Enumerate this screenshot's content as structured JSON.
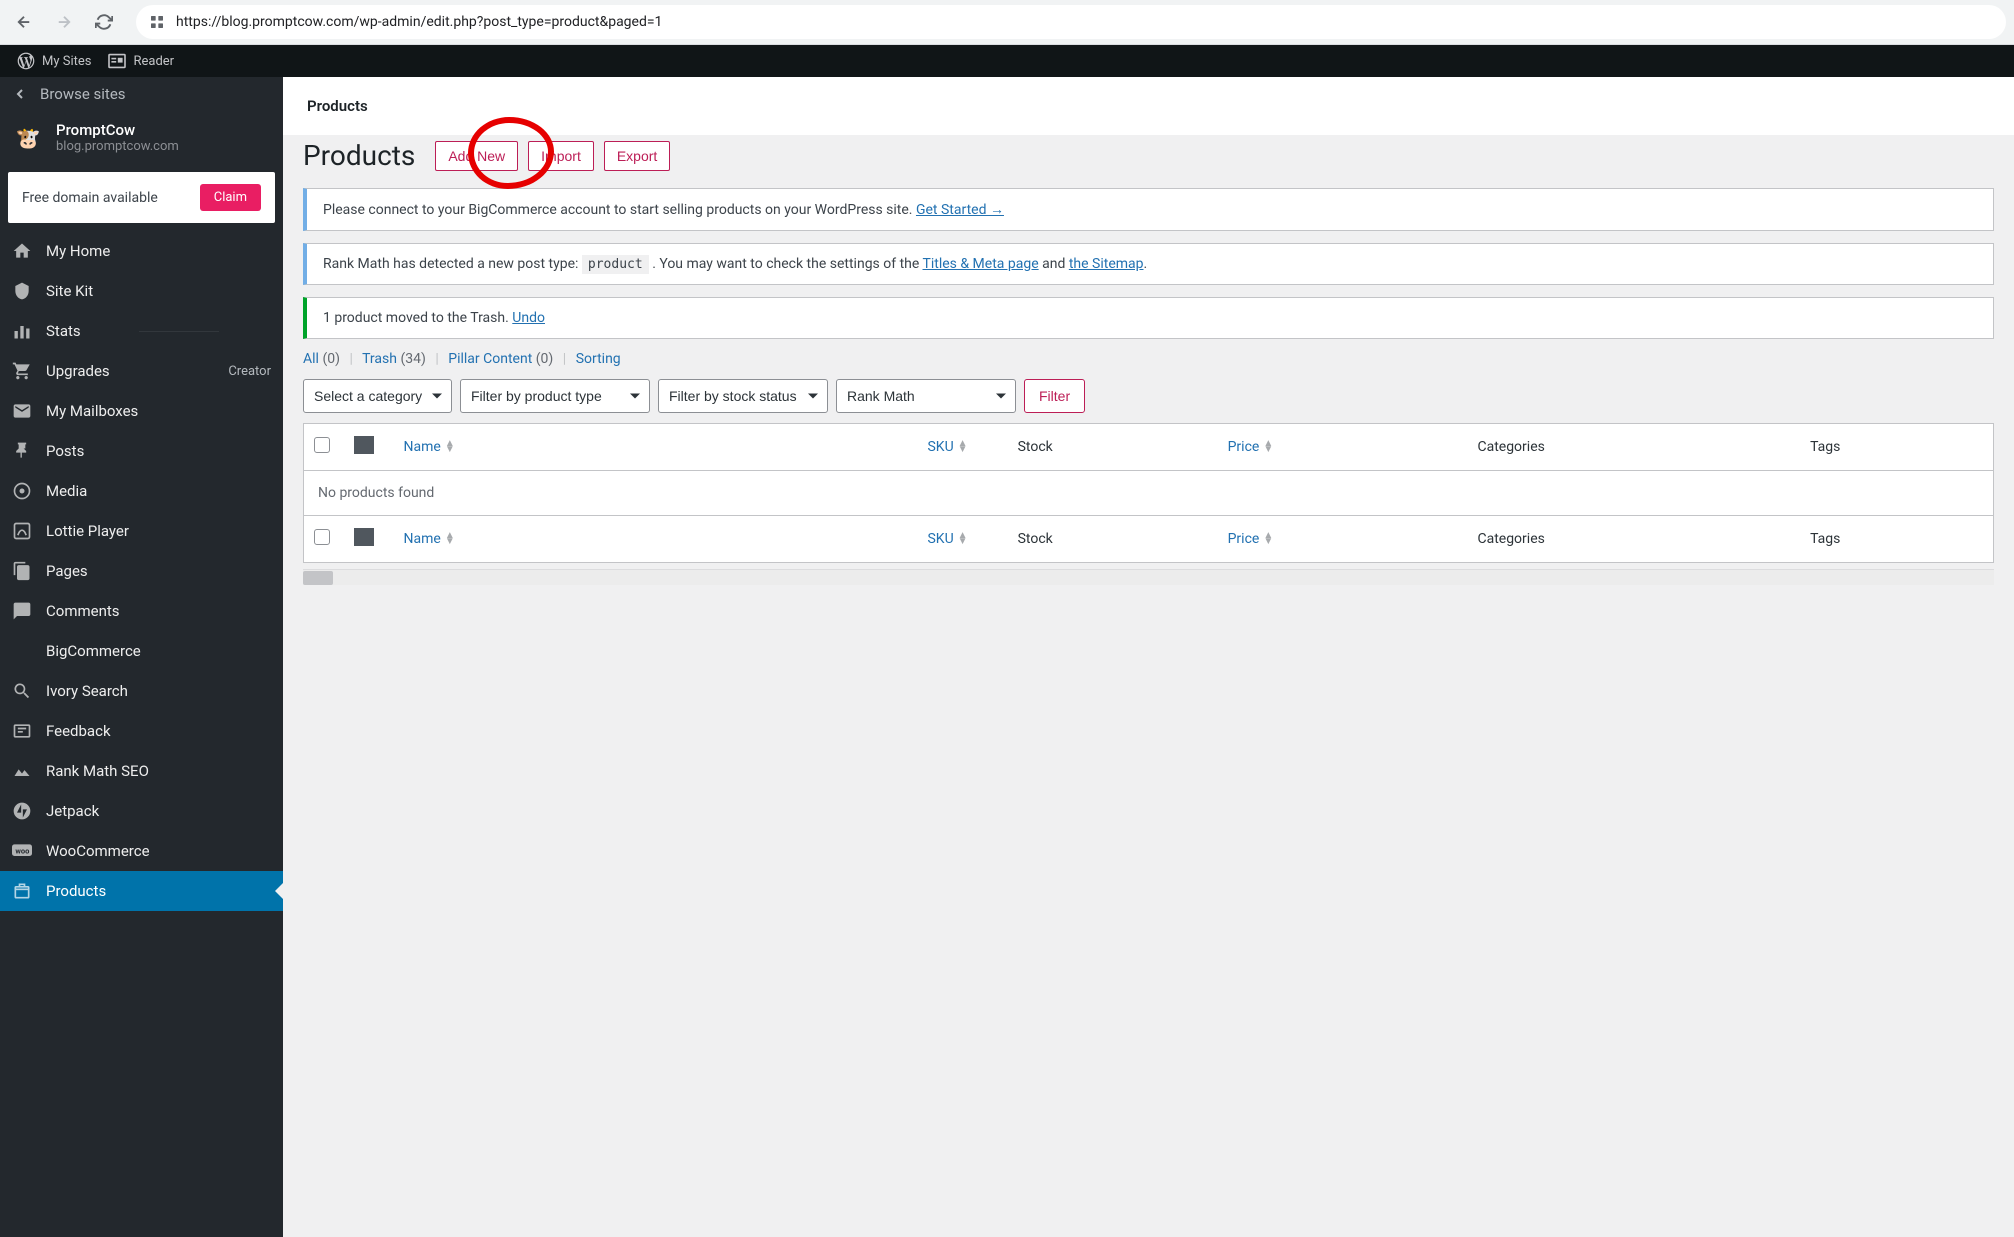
{
  "browser": {
    "url": "https://blog.promptcow.com/wp-admin/edit.php?post_type=product&paged=1"
  },
  "adminbar": {
    "my_sites": "My Sites",
    "reader": "Reader"
  },
  "sidebar": {
    "browse_sites": "Browse sites",
    "site_name": "PromptCow",
    "site_url": "blog.promptcow.com",
    "domain_label": "Free domain available",
    "claim": "Claim",
    "menu": [
      {
        "id": "my-home",
        "label": "My Home"
      },
      {
        "id": "site-kit",
        "label": "Site Kit"
      },
      {
        "id": "stats",
        "label": "Stats"
      },
      {
        "id": "upgrades",
        "label": "Upgrades",
        "badge": "Creator"
      },
      {
        "id": "mailboxes",
        "label": "My Mailboxes"
      },
      {
        "id": "posts",
        "label": "Posts"
      },
      {
        "id": "media",
        "label": "Media"
      },
      {
        "id": "lottie",
        "label": "Lottie Player"
      },
      {
        "id": "pages",
        "label": "Pages"
      },
      {
        "id": "comments",
        "label": "Comments"
      },
      {
        "id": "bigcommerce",
        "label": "BigCommerce"
      },
      {
        "id": "ivory-search",
        "label": "Ivory Search"
      },
      {
        "id": "feedback",
        "label": "Feedback"
      },
      {
        "id": "rank-math",
        "label": "Rank Math SEO"
      },
      {
        "id": "jetpack",
        "label": "Jetpack"
      },
      {
        "id": "woocommerce",
        "label": "WooCommerce"
      },
      {
        "id": "products",
        "label": "Products"
      }
    ]
  },
  "header": {
    "strip_title": "Products",
    "page_title": "Products",
    "add_new": "Add New",
    "import": "Import",
    "export": "Export"
  },
  "notices": {
    "bigcommerce_pre": "Please connect to your BigCommerce account to start selling products on your WordPress site. ",
    "bigcommerce_link": "Get Started →",
    "rankmath_pre": "Rank Math has detected a new post type: ",
    "rankmath_code": "product",
    "rankmath_mid": " . You may want to check the settings of the ",
    "rankmath_link1": "Titles & Meta page",
    "rankmath_and": " and ",
    "rankmath_link2": "the Sitemap",
    "rankmath_end": ".",
    "trash_pre": "1 product moved to the Trash. ",
    "trash_undo": "Undo"
  },
  "subsubsub": {
    "all_label": "All",
    "all_count": "(0)",
    "trash_label": "Trash",
    "trash_count": "(34)",
    "pillar_label": "Pillar Content",
    "pillar_count": "(0)",
    "sorting": "Sorting"
  },
  "filters": {
    "category": "Select a category",
    "product_type": "Filter by product type",
    "stock_status": "Filter by stock status",
    "rank_math": "Rank Math",
    "filter_btn": "Filter"
  },
  "table": {
    "cols": {
      "name": "Name",
      "sku": "SKU",
      "stock": "Stock",
      "price": "Price",
      "categories": "Categories",
      "tags": "Tags"
    },
    "no_items": "No products found"
  }
}
